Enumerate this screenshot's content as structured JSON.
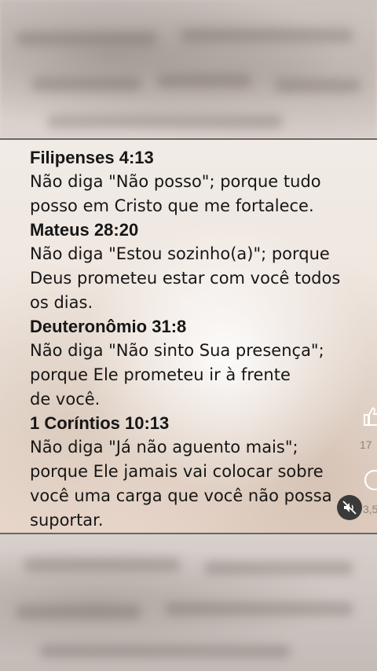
{
  "verses": [
    {
      "reference": "Filipenses 4:13",
      "lines": [
        "Não diga \"Não posso\"; porque tudo",
        "posso em Cristo que me fortalece."
      ]
    },
    {
      "reference": "Mateus 28:20",
      "lines": [
        "Não diga \"Estou sozinho(a)\"; porque",
        "Deus prometeu estar com você todos",
        "os dias."
      ]
    },
    {
      "reference": "Deuteronômio 31:8",
      "lines": [
        "Não diga \"Não sinto Sua presença\";",
        "porque Ele prometeu ir à frente",
        "de você."
      ]
    },
    {
      "reference": "1 Coríntios 10:13",
      "lines": [
        "Não diga \"Já não aguento mais\";",
        "porque Ele jamais vai colocar sobre",
        "você uma carga que você não possa",
        "suportar."
      ]
    }
  ],
  "side_actions": {
    "like_count": "17",
    "comment_count": "3,5",
    "like_icon": "thumbs-up-icon",
    "comment_icon": "comment-icon",
    "mute_icon": "muted-speaker-icon"
  }
}
